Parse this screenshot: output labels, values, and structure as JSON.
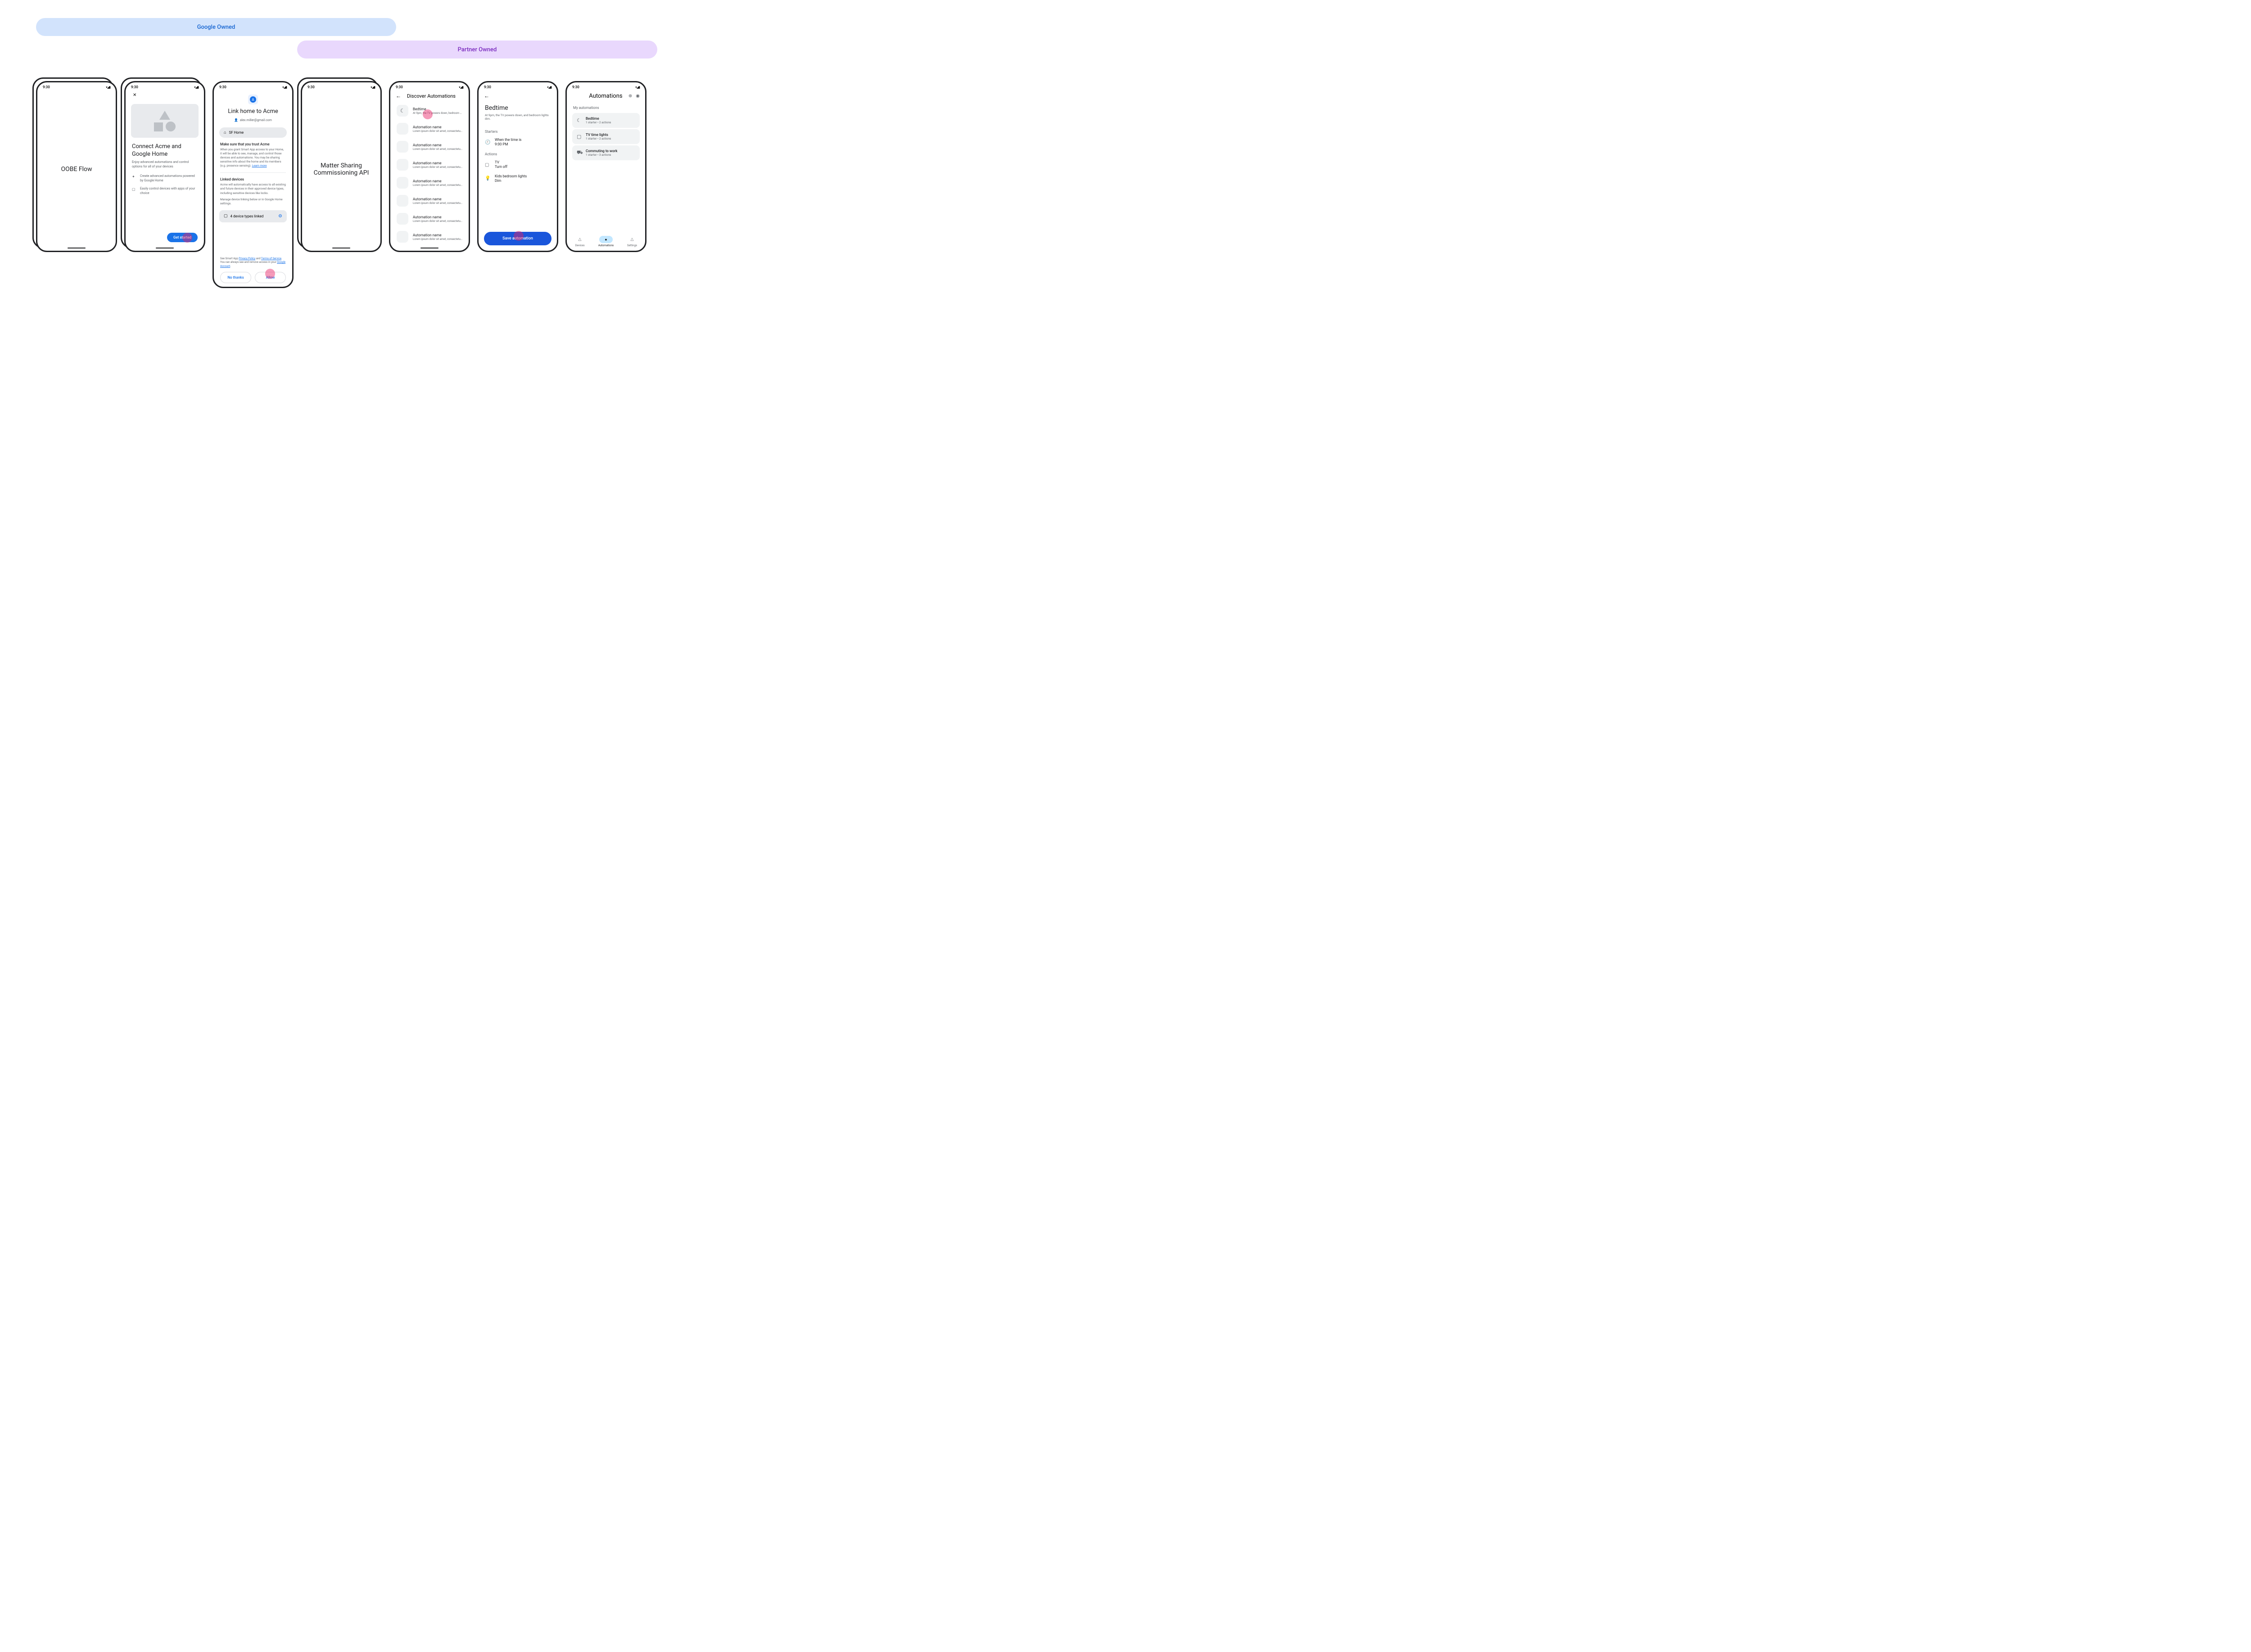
{
  "banners": {
    "google": "Google Owned",
    "partner": "Partner Owned"
  },
  "time": "9:30",
  "p1": {
    "label": "OOBE Flow"
  },
  "p2": {
    "title": "Connect Acme and Google Home",
    "subtitle": "Enjoy advanced automations and control options for all of your devices",
    "li1": "Create advanced automations powered by Google Home",
    "li2": "Easily control devices with apps of your choice",
    "cta": "Get started"
  },
  "p3": {
    "title": "Link home to Acme",
    "email": "alex.miller@gmail.com",
    "home": "SF Home",
    "trust_t": "Make sure that you trust Acme",
    "trust_b": "When you grant Smart App access to your Home, it will be able to  see, manage, and control those devices and automations. You may be sharing sensitive info about the home and its members (e.g. presence sensing). ",
    "learn": "Learn more",
    "linked_t": "Linked devices",
    "linked_b": "Acme will automatically have access to all existing and future devices in their approved device types, including sensitive devices like locks.",
    "linked_m": "Manage device linking below or in Google Home settings.",
    "card": "4 device types linked",
    "foota": "See Smart App ",
    "pp": "Privacy Policy",
    "and": " and ",
    "tos": "Terms of Service",
    "footb": ". You can always see and remove access in your ",
    "ga": "Google Account",
    "dot": ".",
    "no": "No thanks",
    "allow": "Allow"
  },
  "p4": {
    "label": "Matter Sharing Commissioning API"
  },
  "p5": {
    "title": "Discover Automations",
    "items": [
      {
        "t": "Bedtime",
        "s": "At 9pm, the TV powers down, bedroom lights dim.",
        "ic": "☾"
      },
      {
        "t": "Automation name",
        "s": "Lorem ipsum dolor sit amet, consectetur adipiscing."
      },
      {
        "t": "Automation name",
        "s": "Lorem ipsum dolor sit amet, consectetur adipiscing."
      },
      {
        "t": "Automation name",
        "s": "Lorem ipsum dolor sit amet, consectetur adipiscing."
      },
      {
        "t": "Automation name",
        "s": "Lorem ipsum dolor sit amet, consectetur adipiscing."
      },
      {
        "t": "Automation name",
        "s": "Lorem ipsum dolor sit amet, consectetur adipiscing."
      },
      {
        "t": "Automation name",
        "s": "Lorem ipsum dolor sit amet, consectetur adipiscing."
      },
      {
        "t": "Automation name",
        "s": "Lorem ipsum dolor sit amet, consectetur adipiscing."
      }
    ]
  },
  "p6": {
    "title": "Bedtime",
    "sub": "At 9pm, the TV powers down, and bedroom lights dim.",
    "starters": "Starters",
    "s1a": "When the time is",
    "s1b": "9:00 PM",
    "actions": "Actions",
    "a1a": "TV",
    "a1b": "Turn off",
    "a2a": "Kids bedroom lights",
    "a2b": "Dim",
    "save": "Save automation"
  },
  "p7": {
    "title": "Automations",
    "sec": "My automations",
    "cards": [
      {
        "ic": "☾",
        "t": "Bedtime",
        "s": "1 starter • 2 actions"
      },
      {
        "ic": "▢",
        "t": "TV time lights",
        "s": "1 starter • 2 actions"
      },
      {
        "ic": "⛟",
        "t": "Commuting to work",
        "s": "1 starter • 3 actions"
      }
    ],
    "nav": {
      "d": "Devices",
      "a": "Automations",
      "s": "Settings"
    }
  }
}
